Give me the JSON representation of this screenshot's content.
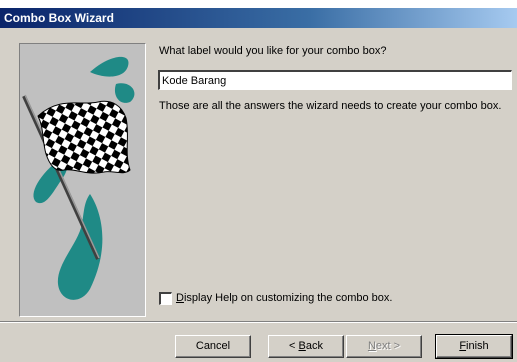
{
  "window": {
    "title": "Combo Box Wizard"
  },
  "prompt": "What label would you like for your combo box?",
  "label_input": {
    "value": "Kode Barang"
  },
  "info": "Those are all the answers the wizard needs to create your combo box.",
  "help_checkbox": {
    "checked": false,
    "label_first": "D",
    "label_rest": "isplay Help on customizing the combo box."
  },
  "buttons": {
    "cancel": "Cancel",
    "back_prefix": "< ",
    "back_mn": "B",
    "back_rest": "ack",
    "next_mn": "N",
    "next_rest": "ext >",
    "finish_mn": "F",
    "finish_rest": "inish"
  },
  "colors": {
    "flag_accent": "#1f8a86",
    "dialog_bg": "#d4d0c8",
    "title_bar": "#0a246a"
  },
  "icons": {
    "picture": "checkered-flag-icon"
  }
}
